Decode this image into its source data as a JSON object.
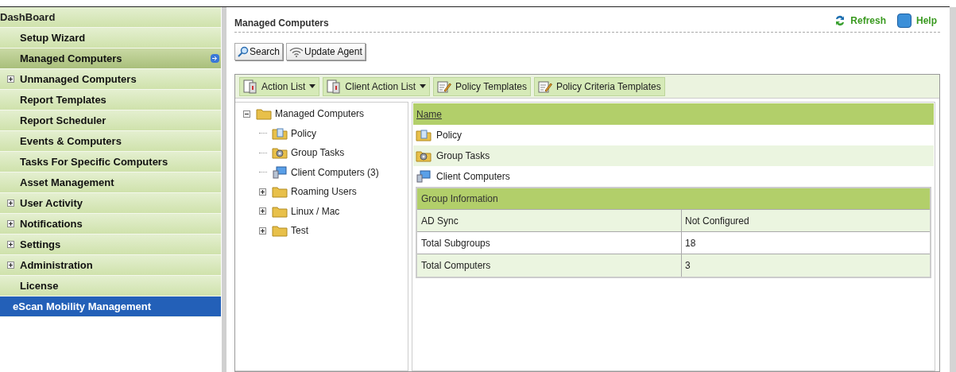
{
  "sidebar": {
    "items": [
      {
        "label": "DashBoard",
        "kind": "header",
        "selected": false
      },
      {
        "label": "Setup Wizard",
        "kind": "item",
        "selected": false,
        "expandable": false
      },
      {
        "label": "Managed Computers",
        "kind": "item",
        "selected": true,
        "expandable": false
      },
      {
        "label": "Unmanaged Computers",
        "kind": "item",
        "selected": false,
        "expandable": true
      },
      {
        "label": "Report Templates",
        "kind": "item",
        "selected": false,
        "expandable": false
      },
      {
        "label": "Report Scheduler",
        "kind": "item",
        "selected": false,
        "expandable": false
      },
      {
        "label": "Events & Computers",
        "kind": "item",
        "selected": false,
        "expandable": false
      },
      {
        "label": "Tasks For Specific Computers",
        "kind": "item",
        "selected": false,
        "expandable": false
      },
      {
        "label": "Asset Management",
        "kind": "item",
        "selected": false,
        "expandable": false
      },
      {
        "label": "User Activity",
        "kind": "item",
        "selected": false,
        "expandable": true
      },
      {
        "label": "Notifications",
        "kind": "item",
        "selected": false,
        "expandable": true
      },
      {
        "label": "Settings",
        "kind": "item",
        "selected": false,
        "expandable": true
      },
      {
        "label": "Administration",
        "kind": "item",
        "selected": false,
        "expandable": true
      },
      {
        "label": "License",
        "kind": "item",
        "selected": false,
        "expandable": false
      },
      {
        "label": "eScan Mobility Management",
        "kind": "special",
        "selected": false
      }
    ]
  },
  "header": {
    "title": "Managed Computers",
    "links": [
      {
        "label": "Refresh",
        "kind": "refresh"
      },
      {
        "label": "Help",
        "kind": "help"
      }
    ]
  },
  "buttons": [
    {
      "label": "Search",
      "kind": "search"
    },
    {
      "label": "Update Agent",
      "kind": "wifi"
    }
  ],
  "toolbar": [
    {
      "label": "Action List",
      "kind": "list",
      "dropdown": true
    },
    {
      "label": "Client Action List",
      "kind": "list",
      "dropdown": true
    },
    {
      "label": "Policy Templates",
      "kind": "edit",
      "dropdown": false
    },
    {
      "label": "Policy Criteria Templates",
      "kind": "edit",
      "dropdown": false
    }
  ],
  "tree": [
    {
      "label": "Managed Computers",
      "kind": "folder",
      "expanded": true,
      "children": [
        {
          "label": "Policy",
          "kind": "policy"
        },
        {
          "label": "Group Tasks",
          "kind": "tasks"
        },
        {
          "label": "Client Computers (3)",
          "kind": "computer"
        },
        {
          "label": "Roaming Users",
          "kind": "folder",
          "expanded": false
        },
        {
          "label": "Linux / Mac",
          "kind": "folder",
          "expanded": false
        },
        {
          "label": "Test",
          "kind": "folder",
          "expanded": false
        }
      ]
    }
  ],
  "list": {
    "column": "Name",
    "rows": [
      {
        "name": "Policy",
        "kind": "policy"
      },
      {
        "name": "Group Tasks",
        "kind": "tasks"
      },
      {
        "name": "Client Computers",
        "kind": "computer"
      }
    ]
  },
  "group_info": {
    "title": "Group Information",
    "rows": [
      {
        "label": "AD Sync",
        "value": "Not Configured"
      },
      {
        "label": "Total Subgroups",
        "value": "18"
      },
      {
        "label": "Total Computers",
        "value": "3"
      }
    ]
  }
}
